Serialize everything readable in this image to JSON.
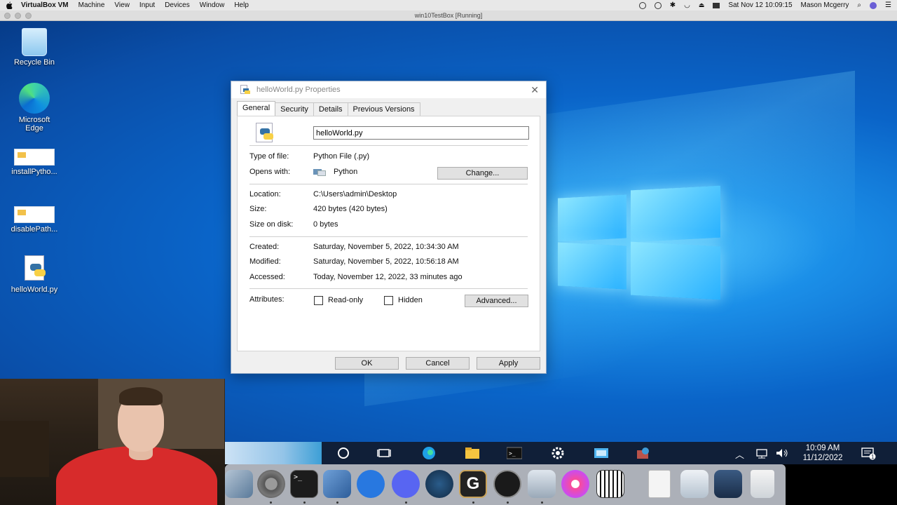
{
  "mac_menubar": {
    "app_name": "VirtualBox VM",
    "menus": [
      "Machine",
      "View",
      "Input",
      "Devices",
      "Window",
      "Help"
    ],
    "datetime": "Sat Nov 12  10:09:15",
    "user": "Mason Mcgerry"
  },
  "vm_window": {
    "title": "win10TestBox [Running]"
  },
  "desktop_icons": [
    {
      "label": "Recycle Bin"
    },
    {
      "label": "Microsoft Edge"
    },
    {
      "label": "installPytho..."
    },
    {
      "label": "disablePath..."
    },
    {
      "label": "helloWorld.py"
    }
  ],
  "dialog": {
    "title": "helloWorld.py Properties",
    "tabs": [
      "General",
      "Security",
      "Details",
      "Previous Versions"
    ],
    "filename": "helloWorld.py",
    "type_label": "Type of file:",
    "type_value": "Python File (.py)",
    "opens_label": "Opens with:",
    "opens_value": "Python",
    "change_button": "Change...",
    "location_label": "Location:",
    "location_value": "C:\\Users\\admin\\Desktop",
    "size_label": "Size:",
    "size_value": "420 bytes (420 bytes)",
    "size_disk_label": "Size on disk:",
    "size_disk_value": "0 bytes",
    "created_label": "Created:",
    "created_value": "Saturday, November 5, 2022, 10:34:30 AM",
    "modified_label": "Modified:",
    "modified_value": "Saturday, November 5, 2022, 10:56:18 AM",
    "accessed_label": "Accessed:",
    "accessed_value": "Today, November 12, 2022, 33 minutes ago",
    "attributes_label": "Attributes:",
    "readonly_label": "Read-only",
    "hidden_label": "Hidden",
    "advanced_button": "Advanced...",
    "ok_button": "OK",
    "cancel_button": "Cancel",
    "apply_button": "Apply"
  },
  "taskbar": {
    "time": "10:09 AM",
    "date": "11/12/2022",
    "notification_count": "1"
  },
  "colors": {
    "desktop_blue": "#0a64c8",
    "taskbar": "#101f38",
    "shirt_red": "#d72b2b"
  }
}
